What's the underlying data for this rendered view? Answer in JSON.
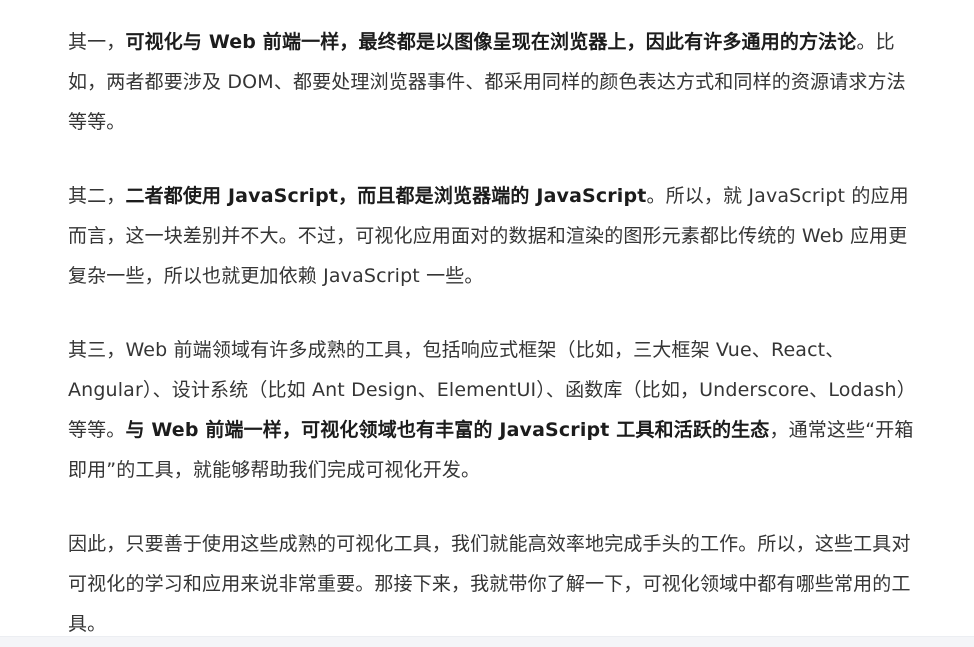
{
  "article": {
    "paragraphs": [
      {
        "segments": [
          {
            "text": "其一，",
            "bold": false
          },
          {
            "text": "可视化与 Web 前端一样，最终都是以图像呈现在浏览器上，因此有许多通用的方法论",
            "bold": true
          },
          {
            "text": "。比如，两者都要涉及 DOM、都要处理浏览器事件、都采用同样的颜色表达方式和同样的资源请求方法等等。",
            "bold": false
          }
        ]
      },
      {
        "segments": [
          {
            "text": "其二，",
            "bold": false
          },
          {
            "text": "二者都使用 JavaScript，而且都是浏览器端的 JavaScript",
            "bold": true
          },
          {
            "text": "。所以，就 JavaScript 的应用而言，这一块差别并不大。不过，可视化应用面对的数据和渲染的图形元素都比传统的 Web 应用更复杂一些，所以也就更加依赖 JavaScript 一些。",
            "bold": false
          }
        ]
      },
      {
        "segments": [
          {
            "text": "其三，Web 前端领域有许多成熟的工具，包括响应式框架（比如，三大框架 Vue、React、Angular）、设计系统（比如 Ant Design、ElementUI）、函数库（比如，Underscore、Lodash）等等。",
            "bold": false
          },
          {
            "text": "与 Web 前端一样，可视化领域也有丰富的 JavaScript 工具和活跃的生态",
            "bold": true
          },
          {
            "text": "，通常这些“开箱即用”的工具，就能够帮助我们完成可视化开发。",
            "bold": false
          }
        ]
      },
      {
        "segments": [
          {
            "text": "因此，只要善于使用这些成熟的可视化工具，我们就能高效率地完成手头的工作。所以，这些工具对可视化的学习和应用来说非常重要。那接下来，我就带你了解一下，可视化领域中都有哪些常用的工具。",
            "bold": false
          }
        ]
      }
    ]
  }
}
